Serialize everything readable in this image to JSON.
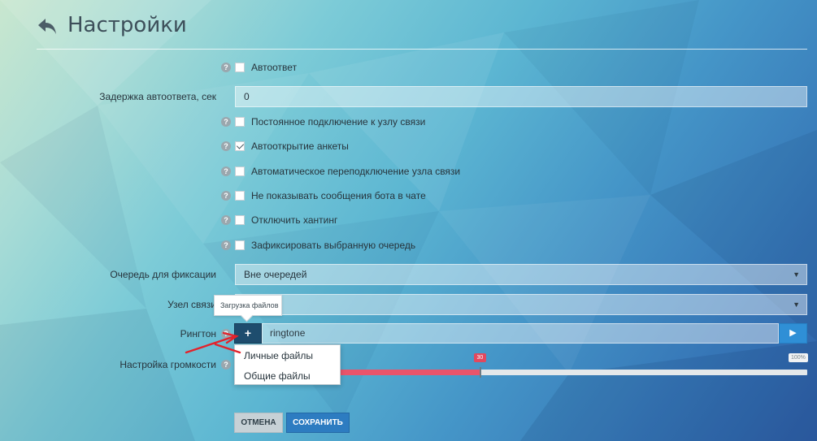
{
  "header": {
    "title": "Настройки"
  },
  "form": {
    "autoreply_label": "Автоответ",
    "delay_label": "Задержка автоответа, сек",
    "delay_value": "0",
    "persistent_label": "Постоянное подключение к узлу связи",
    "autoopen_label": "Автооткрытие анкеты",
    "autoreconnect_label": "Автоматическое переподключение узла связи",
    "hidebot_label": "Не показывать сообщения бота в чате",
    "hunting_label": "Отключить хантинг",
    "fixqueue_label": "Зафиксировать выбранную очередь",
    "queue_label": "Очередь для фиксации",
    "queue_value": "Вне очередей",
    "node_label": "Узел связи",
    "node_value": "",
    "ringtone_label": "Рингтон",
    "ringtone_value": "ringtone",
    "volume_label": "Настройка громкости",
    "volume_value_label": "30",
    "volume_max_label": "100%",
    "volume_fraction": 0.3,
    "help_glyph": "?",
    "upload_glyph": "+",
    "play_glyph": "▶",
    "select_arrow": "▼"
  },
  "tooltip": {
    "text": "Загрузка файлов"
  },
  "dropdown": {
    "items": [
      "Личные файлы",
      "Общие файлы"
    ]
  },
  "buttons": {
    "cancel": "ОТМЕНА",
    "save": "СОХРАНИТЬ"
  },
  "colors": {
    "accent": "#2d7cc1",
    "slider_fill": "#e9546b",
    "upload_bg": "#1e4d6e",
    "annotation": "#e3222b"
  },
  "icons": {
    "back": "undo-arrow-icon",
    "help": "help-circle-icon",
    "upload": "plus-icon",
    "play": "play-icon"
  }
}
